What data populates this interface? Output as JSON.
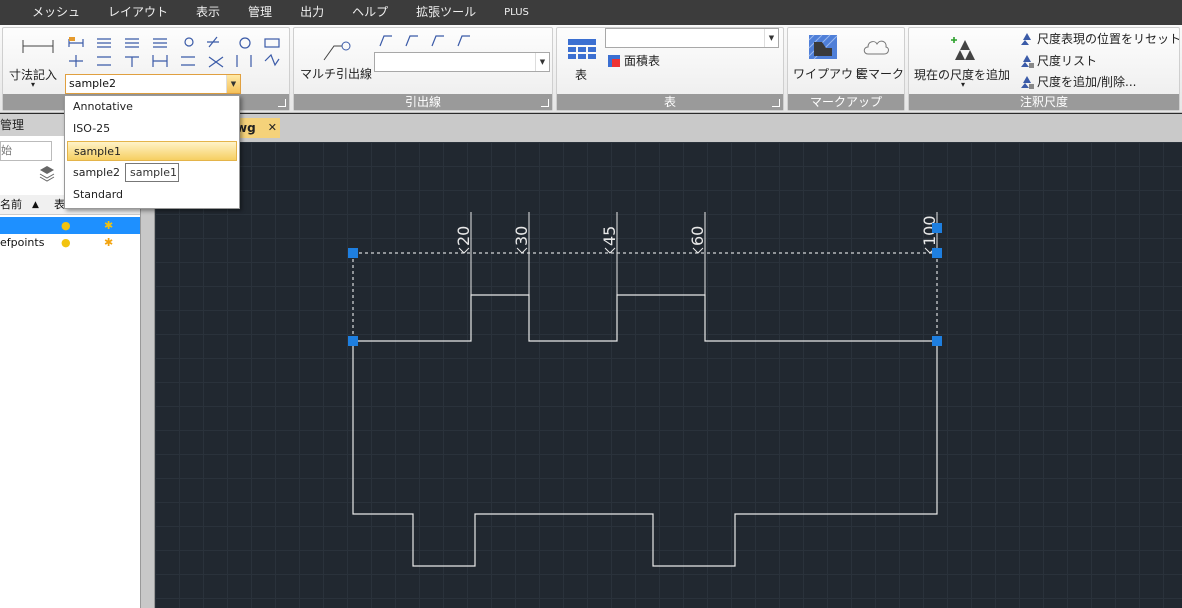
{
  "menu": {
    "items": [
      "",
      "メッシュ",
      "レイアウト",
      "表示",
      "管理",
      "出力",
      "ヘルプ",
      "拡張ツール",
      "PLUS"
    ]
  },
  "ribbon": {
    "dimension": {
      "big_label": "寸法記入",
      "style_combo_value": "sample2"
    },
    "leader": {
      "title": "引出線",
      "multileader_label": "マルチ引出線"
    },
    "table": {
      "title": "表",
      "table_label": "表",
      "area_table_label": "面積表"
    },
    "markup": {
      "title": "マークアップ",
      "wipeout_label": "ワイプアウト",
      "cloud_label": "雲マーク"
    },
    "annoscale": {
      "title": "注釈尺度",
      "add_current_label": "現在の尺度を追加",
      "reset_label": "尺度表現の位置をリセット",
      "list_label": "尺度リスト",
      "add_delete_label": "尺度を追加/削除..."
    }
  },
  "left_panel": {
    "header": "管理",
    "search_placeholder": "始",
    "col_name": "名前",
    "col_show": "表",
    "rows": [
      "",
      "efpoints"
    ]
  },
  "doc_tab": {
    "label": "wg"
  },
  "dropdown": {
    "items": [
      "Annotative",
      "ISO-25",
      "sample1",
      "sample2",
      "Standard"
    ],
    "highlighted": "sample1",
    "tooltip": "sample1"
  },
  "drawing": {
    "dimensions": [
      "20",
      "30",
      "45",
      "60",
      "100"
    ],
    "line_color": "#e8e8e8",
    "grip_color": "#1e7fe0"
  },
  "colors": {
    "menubar": "#3c3c3c",
    "canvas": "#212830",
    "selection": "#1e90ff",
    "highlight": "#f6cf62"
  }
}
